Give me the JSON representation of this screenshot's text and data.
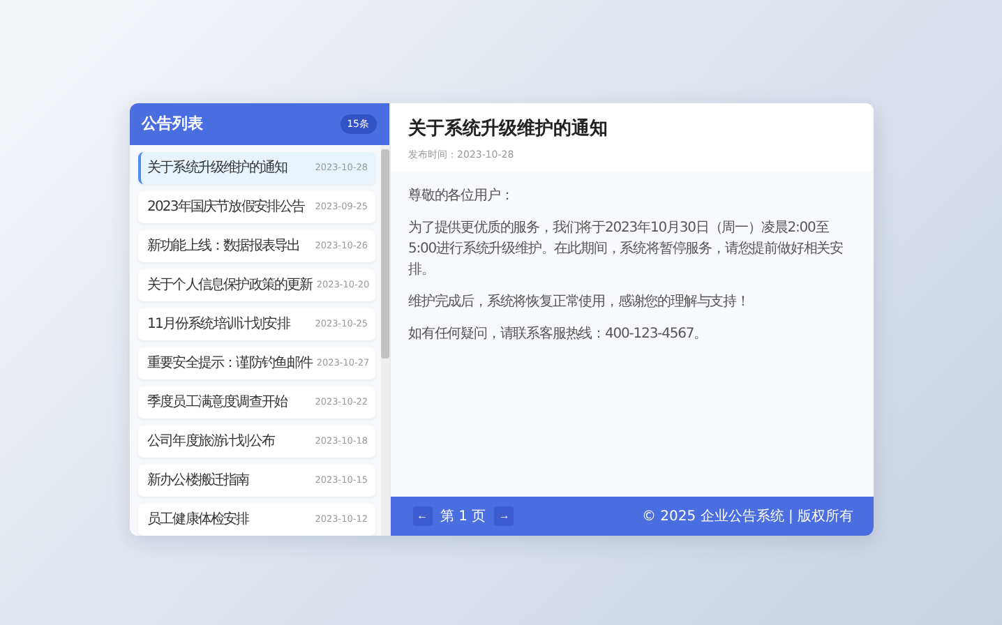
{
  "sidebar": {
    "title": "公告列表",
    "count": "15条",
    "items": [
      {
        "title": "关于系统升级维护的通知",
        "date": "2023-10-28",
        "selected": true
      },
      {
        "title": "2023年国庆节放假安排公告",
        "date": "2023-09-25",
        "selected": false
      },
      {
        "title": "新功能上线：数据报表导出",
        "date": "2023-10-26",
        "selected": false
      },
      {
        "title": "关于个人信息保护政策的更新",
        "date": "2023-10-20",
        "selected": false
      },
      {
        "title": "11月份系统培训计划安排",
        "date": "2023-10-25",
        "selected": false
      },
      {
        "title": "重要安全提示：谨防钓鱼邮件",
        "date": "2023-10-27",
        "selected": false
      },
      {
        "title": "季度员工满意度调查开始",
        "date": "2023-10-22",
        "selected": false
      },
      {
        "title": "公司年度旅游计划公布",
        "date": "2023-10-18",
        "selected": false
      },
      {
        "title": "新办公楼搬迁指南",
        "date": "2023-10-15",
        "selected": false
      },
      {
        "title": "员工健康体检安排",
        "date": "2023-10-12",
        "selected": false
      }
    ]
  },
  "article": {
    "title": "关于系统升级维护的通知",
    "meta": "发布时间：2023-10-28",
    "paragraphs": [
      "尊敬的各位用户：",
      "为了提供更优质的服务，我们将于2023年10月30日（周一）凌晨2:00至5:00进行系统升级维护。在此期间，系统将暂停服务，请您提前做好相关安排。",
      "维护完成后，系统将恢复正常使用，感谢您的理解与支持！",
      "如有任何疑问，请联系客服热线：400-123-4567。"
    ]
  },
  "footer": {
    "prev": "←",
    "page": "第 1 页",
    "next": "→",
    "copyright": "© 2025 企业公告系统 | 版权所有"
  }
}
